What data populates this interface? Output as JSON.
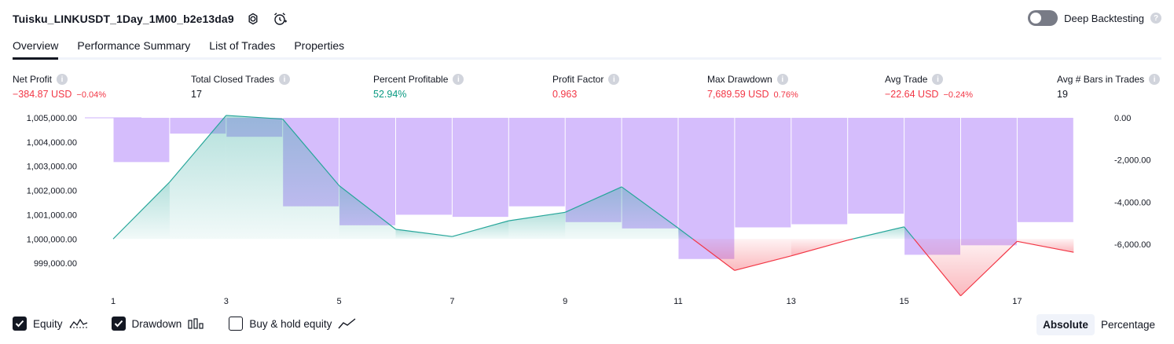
{
  "header": {
    "title": "Tuisku_LINKUSDT_1Day_1M00_b2e13da9",
    "settings_icon": "gear-icon",
    "alert_icon": "add-alert-icon"
  },
  "deep_backtesting": {
    "label": "Deep Backtesting",
    "enabled": false,
    "help": "?"
  },
  "tabs": [
    {
      "label": "Overview",
      "active": true
    },
    {
      "label": "Performance Summary",
      "active": false
    },
    {
      "label": "List of Trades",
      "active": false
    },
    {
      "label": "Properties",
      "active": false
    }
  ],
  "metrics": [
    {
      "label": "Net Profit",
      "value": "−384.87 USD",
      "pct": "−0.04%",
      "color": "red",
      "help": "i"
    },
    {
      "label": "Total Closed Trades",
      "value": "17",
      "pct": "",
      "color": "neutral",
      "help": "i"
    },
    {
      "label": "Percent Profitable",
      "value": "52.94%",
      "pct": "",
      "color": "green",
      "help": "i"
    },
    {
      "label": "Profit Factor",
      "value": "0.963",
      "pct": "",
      "color": "red",
      "help": "i"
    },
    {
      "label": "Max Drawdown",
      "value": "7,689.59 USD",
      "pct": "0.76%",
      "color": "red",
      "help": "i"
    },
    {
      "label": "Avg Trade",
      "value": "−22.64 USD",
      "pct": "−0.24%",
      "color": "red",
      "help": "i"
    },
    {
      "label": "Avg # Bars in Trades",
      "value": "19",
      "pct": "",
      "color": "neutral",
      "help": "i"
    }
  ],
  "chart_data": {
    "type": "area",
    "left_axis": {
      "ticks": [
        "1,005,000.00",
        "1,004,000.00",
        "1,003,000.00",
        "1,002,000.00",
        "1,001,000.00",
        "1,000,000.00",
        "999,000.00"
      ],
      "range": [
        998700,
        1005200
      ]
    },
    "right_axis": {
      "ticks": [
        "0.00",
        "-2,000.00",
        "-4,000.00",
        "-6,000.00"
      ],
      "range": [
        -6500,
        0
      ]
    },
    "x_ticks": [
      "1",
      "3",
      "5",
      "7",
      "9",
      "11",
      "13",
      "15",
      "17"
    ],
    "equity": {
      "name": "Equity",
      "x": [
        1,
        2,
        3,
        4,
        5,
        6,
        7,
        8,
        9,
        10,
        11,
        12,
        13,
        14,
        15,
        16,
        17,
        18
      ],
      "y": [
        1000000,
        1002350,
        1005100,
        1004950,
        1002200,
        1000400,
        1000100,
        1000750,
        1001100,
        1002150,
        1000450,
        998700,
        999300,
        999950,
        1000500,
        997650,
        999900,
        999450
      ],
      "baseline": 1000000
    },
    "drawdown": {
      "name": "Drawdown",
      "trades": [
        2,
        3,
        4,
        5,
        6,
        7,
        8,
        9,
        10,
        11,
        12,
        13,
        14,
        15,
        16,
        17,
        18
      ],
      "values": [
        -2100,
        -750,
        -900,
        -4200,
        -5100,
        -4600,
        -4700,
        -4200,
        -4950,
        -5250,
        -6700,
        -5200,
        -5050,
        -4550,
        -6500,
        -6050,
        -4950
      ]
    },
    "colors": {
      "equity_pos": "#26a69a",
      "equity_neg": "#f23645",
      "drawdown": "#ceb1fb"
    }
  },
  "legend": {
    "items": [
      {
        "label": "Equity",
        "checked": true,
        "icon": "equity-line-icon"
      },
      {
        "label": "Drawdown",
        "checked": true,
        "icon": "drawdown-bars-icon"
      },
      {
        "label": "Buy & hold equity",
        "checked": false,
        "icon": "buy-hold-line-icon"
      }
    ]
  },
  "mode": {
    "absolute": "Absolute",
    "percentage": "Percentage",
    "selected": "Absolute"
  }
}
